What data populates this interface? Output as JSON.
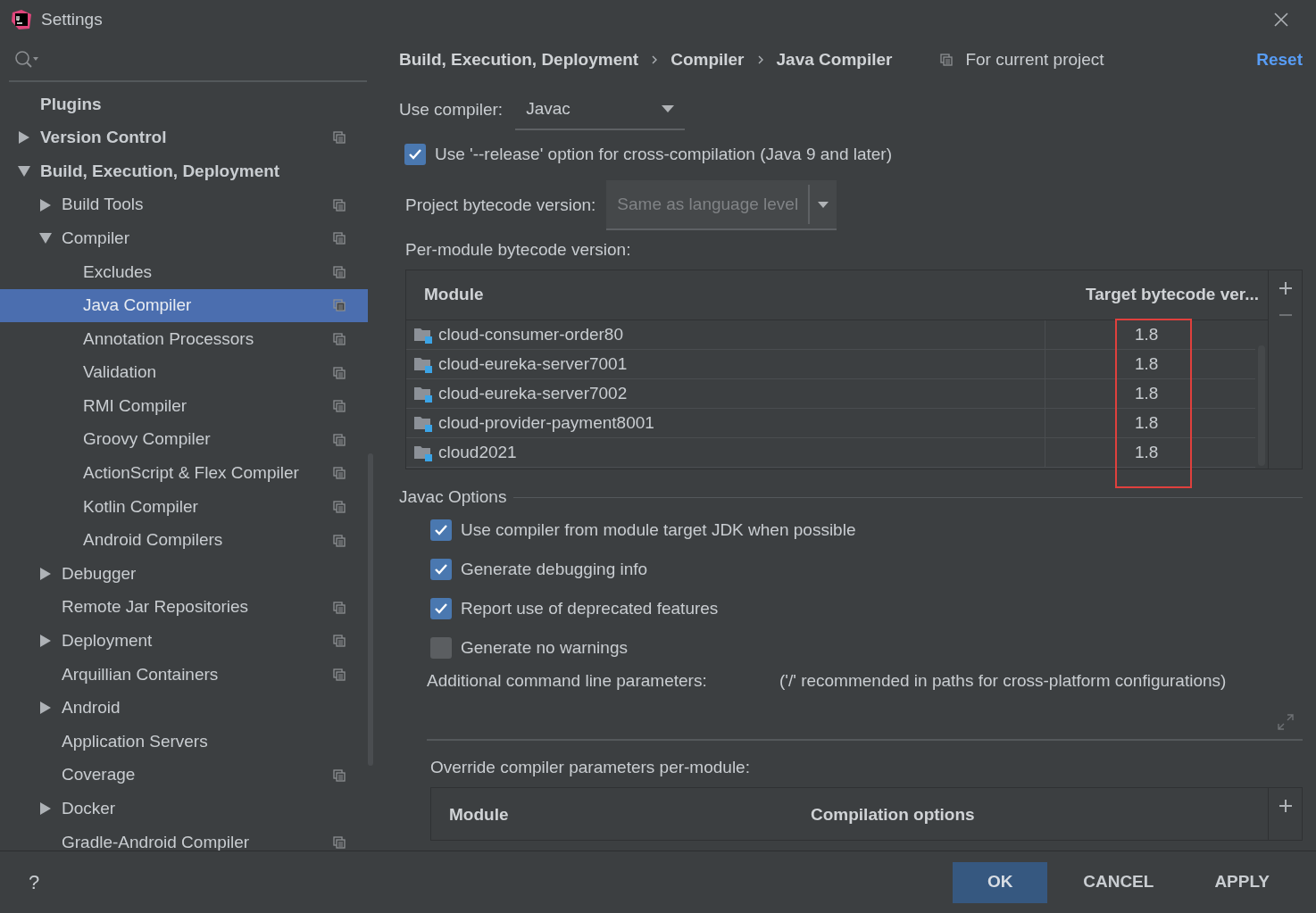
{
  "window": {
    "title": "Settings"
  },
  "sidebar": {
    "items": [
      {
        "label": "Plugins",
        "selected": false,
        "project_level": false
      },
      {
        "label": "Version Control",
        "selected": false,
        "project_level": true,
        "expanded": false
      },
      {
        "label": "Build, Execution, Deployment",
        "selected": false,
        "project_level": false,
        "expanded": true,
        "children": [
          {
            "label": "Build Tools",
            "selected": false,
            "project_level": true,
            "expanded": false
          },
          {
            "label": "Compiler",
            "selected": false,
            "project_level": true,
            "expanded": true,
            "children": [
              {
                "label": "Excludes",
                "selected": false,
                "project_level": true
              },
              {
                "label": "Java Compiler",
                "selected": true,
                "project_level": true
              },
              {
                "label": "Annotation Processors",
                "selected": false,
                "project_level": true
              },
              {
                "label": "Validation",
                "selected": false,
                "project_level": true
              },
              {
                "label": "RMI Compiler",
                "selected": false,
                "project_level": true
              },
              {
                "label": "Groovy Compiler",
                "selected": false,
                "project_level": true
              },
              {
                "label": "ActionScript & Flex Compiler",
                "selected": false,
                "project_level": true
              },
              {
                "label": "Kotlin Compiler",
                "selected": false,
                "project_level": true
              },
              {
                "label": "Android Compilers",
                "selected": false,
                "project_level": true
              }
            ]
          },
          {
            "label": "Debugger",
            "selected": false,
            "project_level": false,
            "expanded": false
          },
          {
            "label": "Remote Jar Repositories",
            "selected": false,
            "project_level": true
          },
          {
            "label": "Deployment",
            "selected": false,
            "project_level": true,
            "expanded": false
          },
          {
            "label": "Arquillian Containers",
            "selected": false,
            "project_level": true
          },
          {
            "label": "Android",
            "selected": false,
            "project_level": false,
            "expanded": false
          },
          {
            "label": "Application Servers",
            "selected": false,
            "project_level": false
          },
          {
            "label": "Coverage",
            "selected": false,
            "project_level": true
          },
          {
            "label": "Docker",
            "selected": false,
            "project_level": false,
            "expanded": false
          },
          {
            "label": "Gradle-Android Compiler",
            "selected": false,
            "project_level": true
          }
        ]
      }
    ]
  },
  "breadcrumbs": [
    "Build, Execution, Deployment",
    "Compiler",
    "Java Compiler"
  ],
  "scope_label": "For current project",
  "reset": "Reset",
  "use_compiler": {
    "label": "Use compiler:",
    "value": "Javac"
  },
  "release_option": {
    "label": "Use '--release' option for cross-compilation (Java 9 and later)",
    "checked": true
  },
  "project_bytecode": {
    "label": "Project bytecode version:",
    "value": "Same as language level",
    "disabled": true
  },
  "per_module_label": "Per-module bytecode version:",
  "module_table": {
    "columns": [
      "Module",
      "Target bytecode ver..."
    ],
    "rows": [
      {
        "module": "cloud-consumer-order80",
        "target": "1.8"
      },
      {
        "module": "cloud-eureka-server7001",
        "target": "1.8"
      },
      {
        "module": "cloud-eureka-server7002",
        "target": "1.8"
      },
      {
        "module": "cloud-provider-payment8001",
        "target": "1.8"
      },
      {
        "module": "cloud2021",
        "target": "1.8"
      }
    ]
  },
  "javac_options": {
    "title": "Javac Options",
    "checkboxes": [
      {
        "label": "Use compiler from module target JDK when possible",
        "checked": true
      },
      {
        "label": "Generate debugging info",
        "checked": true
      },
      {
        "label": "Report use of deprecated features",
        "checked": true
      },
      {
        "label": "Generate no warnings",
        "checked": false
      }
    ],
    "params_label": "Additional command line parameters:",
    "params_hint": "('/' recommended in paths for cross-platform configurations)"
  },
  "override_label": "Override compiler parameters per-module:",
  "override_table": {
    "columns": [
      "Module",
      "Compilation options"
    ]
  },
  "footer": {
    "help": "?",
    "buttons": [
      {
        "label": "OK",
        "primary": true
      },
      {
        "label": "CANCEL",
        "primary": false
      },
      {
        "label": "APPLY",
        "primary": false
      }
    ]
  }
}
